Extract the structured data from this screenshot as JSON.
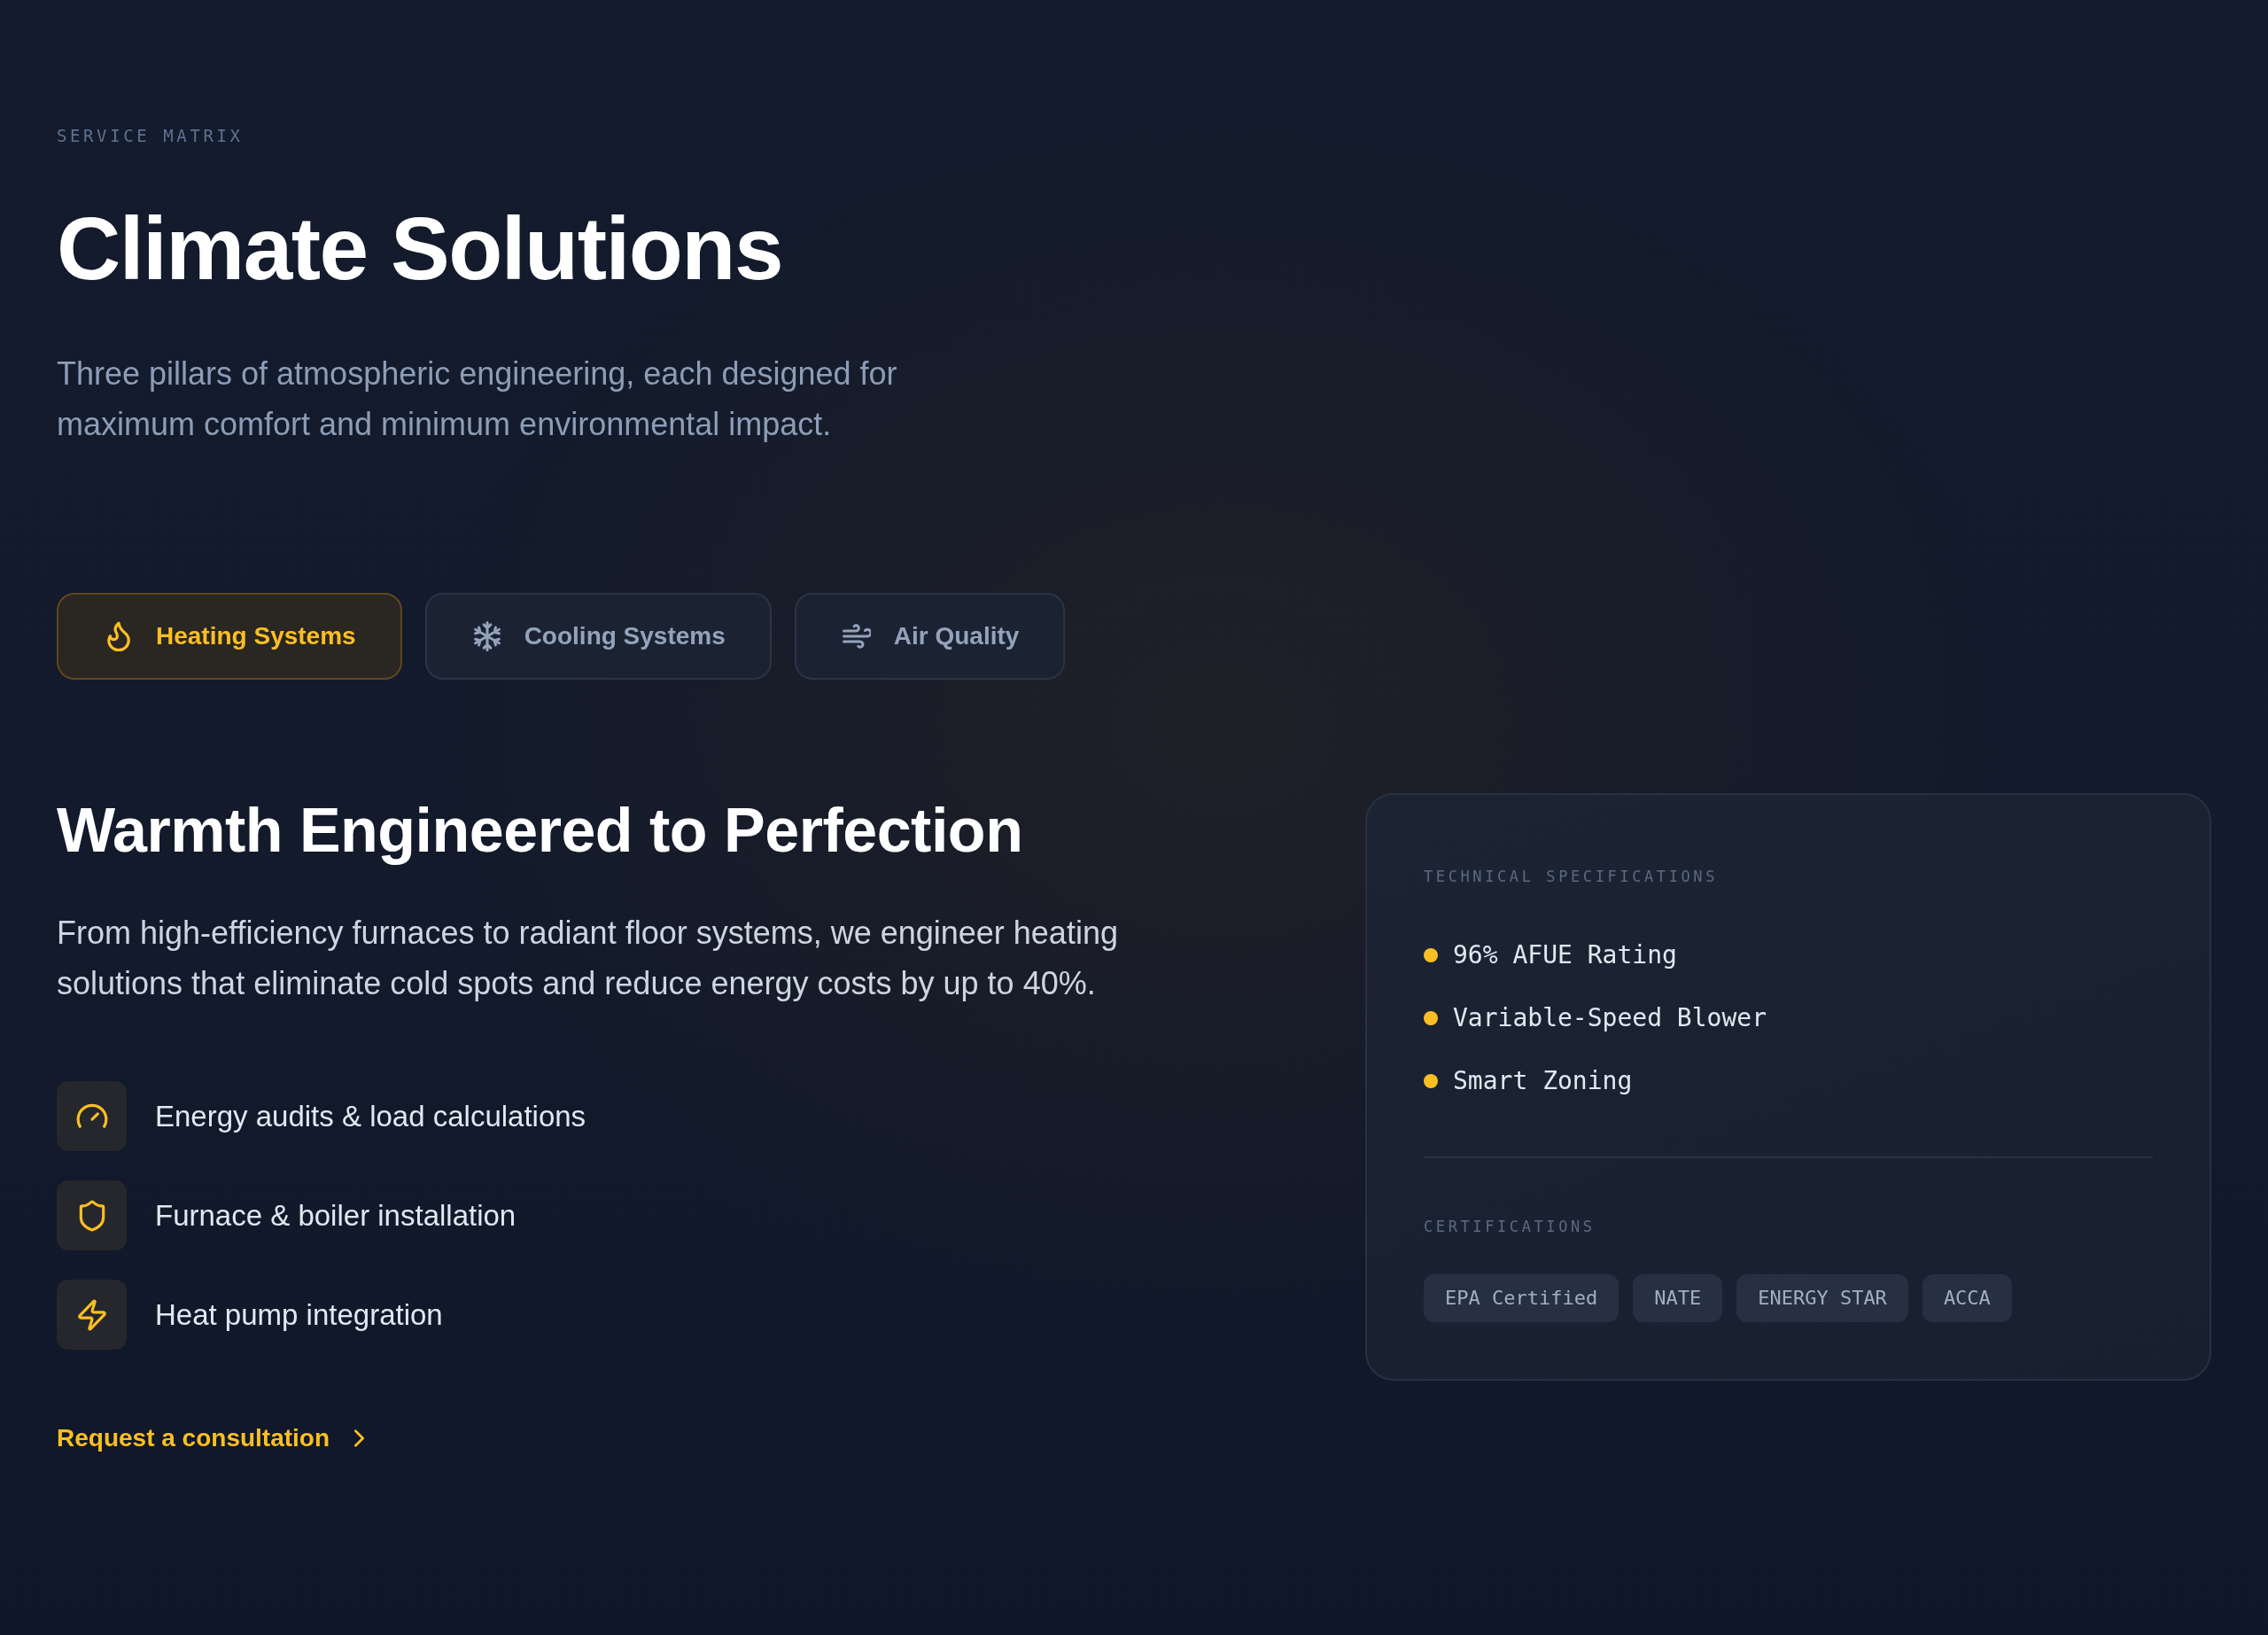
{
  "header": {
    "eyebrow": "SERVICE MATRIX",
    "title": "Climate Solutions",
    "subtitle": "Three pillars of atmospheric engineering, each designed for maximum comfort and minimum environmental impact."
  },
  "tabs": [
    {
      "label": "Heating Systems",
      "selected": true
    },
    {
      "label": "Cooling Systems",
      "selected": false
    },
    {
      "label": "Air Quality",
      "selected": false
    }
  ],
  "panel": {
    "heading": "Warmth Engineered to Perfection",
    "description": "From high-efficiency furnaces to radiant floor systems, we engineer heating solutions that eliminate cold spots and reduce energy costs by up to 40%.",
    "features": [
      "Energy audits & load calculations",
      "Furnace & boiler installation",
      "Heat pump integration"
    ],
    "link": "Request a consultation"
  },
  "specs_card": {
    "specs_label": "TECHNICAL SPECIFICATIONS",
    "specs": [
      "96% AFUE Rating",
      "Variable-Speed Blower",
      "Smart Zoning"
    ],
    "certifications_label": "CERTIFICATIONS",
    "certifications": [
      "EPA Certified",
      "NATE",
      "ENERGY STAR",
      "ACCA"
    ]
  }
}
